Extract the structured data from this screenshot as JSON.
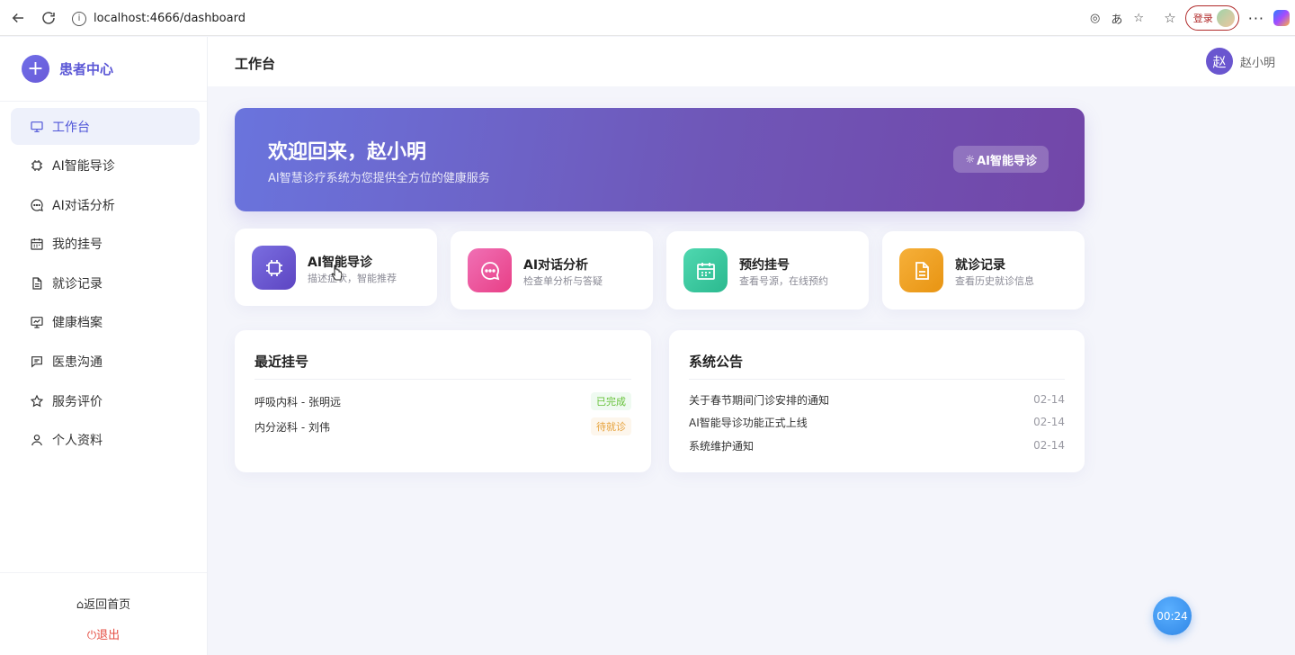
{
  "browser": {
    "url": "localhost:4666/dashboard",
    "login_label": "登录"
  },
  "sidebar": {
    "brand": "患者中心",
    "items": [
      {
        "label": "工作台",
        "icon": "monitor-icon",
        "active": true
      },
      {
        "label": "AI智能导诊",
        "icon": "chip-icon",
        "active": false
      },
      {
        "label": "AI对话分析",
        "icon": "chat-bubble-icon",
        "active": false
      },
      {
        "label": "我的挂号",
        "icon": "calendar-icon",
        "active": false
      },
      {
        "label": "就诊记录",
        "icon": "document-icon",
        "active": false
      },
      {
        "label": "健康档案",
        "icon": "chart-board-icon",
        "active": false
      },
      {
        "label": "医患沟通",
        "icon": "message-icon",
        "active": false
      },
      {
        "label": "服务评价",
        "icon": "star-icon",
        "active": false
      },
      {
        "label": "个人资料",
        "icon": "user-icon",
        "active": false
      }
    ],
    "back_home": "返回首页",
    "logout": "退出"
  },
  "header": {
    "title": "工作台",
    "avatar_text": "赵",
    "user_name": "赵小明"
  },
  "banner": {
    "title": "欢迎回来，赵小明",
    "subtitle": "AI智慧诊疗系统为您提供全方位的健康服务",
    "button": "AI智能导诊"
  },
  "quick_cards": [
    {
      "title": "AI智能导诊",
      "desc": "描述症状，智能推荐",
      "icon": "chip-icon",
      "color": "#6d5bd0"
    },
    {
      "title": "AI对话分析",
      "desc": "检查单分析与答疑",
      "icon": "chat-bubble-icon",
      "color": "#ee4f9a"
    },
    {
      "title": "预约挂号",
      "desc": "查看号源，在线预约",
      "icon": "calendar-icon",
      "color": "#3cc8a0"
    },
    {
      "title": "就诊记录",
      "desc": "查看历史就诊信息",
      "icon": "document-icon",
      "color": "#f0a020"
    }
  ],
  "recent": {
    "title": "最近挂号",
    "rows": [
      {
        "text": "呼吸内科 - 张明远",
        "status": "已完成"
      },
      {
        "text": "内分泌科 - 刘伟",
        "status": "待就诊"
      }
    ]
  },
  "notice": {
    "title": "系统公告",
    "rows": [
      {
        "text": "关于春节期间门诊安排的通知",
        "date": "02-14"
      },
      {
        "text": "AI智能导诊功能正式上线",
        "date": "02-14"
      },
      {
        "text": "系统维护通知",
        "date": "02-14"
      }
    ]
  },
  "timer": "00:24"
}
